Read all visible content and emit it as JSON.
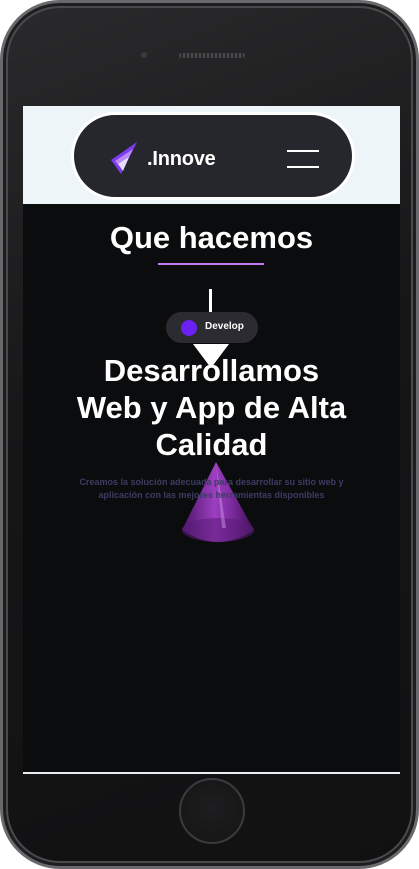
{
  "header": {
    "brand": ".Innove",
    "logo_icon": "innove-logo-icon",
    "menu_icon": "hamburger-menu-icon"
  },
  "section": {
    "title": "Que hacemos",
    "underline_color": "#c67cf0"
  },
  "badge": {
    "label": "Develop",
    "dot_color": "#6b21f2"
  },
  "hero": {
    "headline_line1": "Desarrollamos",
    "headline_line2": "Web y App de Alta",
    "headline_line3": "Calidad",
    "subtitle_line1": "Creamos la solución adecuada para desarrollar su sitio web y",
    "subtitle_line2": "aplicación con las mejores herramientas disponibles",
    "decor_icon": "purple-cone-icon"
  },
  "colors": {
    "screen_background": "#0b0c0e",
    "topbar_background": "#eef5f9",
    "nav_background": "#26262d",
    "accent_purple": "#6b21f2",
    "subtitle_text": "#3b3d63"
  }
}
